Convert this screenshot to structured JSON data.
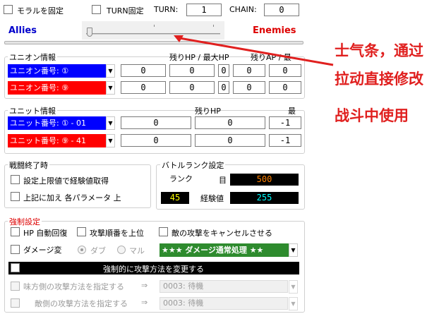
{
  "top": {
    "moral_lock": "モラルを固定",
    "turn_lock": "TURN固定",
    "turn_label": "TURN:",
    "turn_value": "1",
    "chain_label": "CHAIN:",
    "chain_value": "0"
  },
  "morale": {
    "allies": "Allies",
    "enemies": "Enemies"
  },
  "union": {
    "title": "ユニオン情報",
    "header": "残りHP / 最大HP",
    "header_ap": "残りAP / 最",
    "rows": [
      {
        "label": "ユニオン番号: ①",
        "color": "blue",
        "v1": "0",
        "v2": "0",
        "v3": "0",
        "v4": "0",
        "v5": "0"
      },
      {
        "label": "ユニオン番号: ⑨",
        "color": "red",
        "v1": "0",
        "v2": "0",
        "v3": "0",
        "v4": "0",
        "v5": "0"
      }
    ]
  },
  "unit": {
    "title": "ユニット情報",
    "header_hp": "残りHP",
    "header_max": "最",
    "rows": [
      {
        "label": "ユニット番号: ① - 01",
        "color": "blue",
        "v1": "0",
        "v2": "0",
        "v3": "-1"
      },
      {
        "label": "ユニット番号: ⑨ - 41",
        "color": "red",
        "v1": "0",
        "v2": "0",
        "v3": "-1"
      }
    ]
  },
  "battle_end": {
    "title": "戦闘終了時",
    "opt1": "設定上限値で経験値取得",
    "opt2": "上記に加え 各パラメータ 上"
  },
  "battle_rank": {
    "title": "バトルランク設定",
    "rank_label": "ランク",
    "target_label": "目",
    "target_value": "500",
    "rank_value": "45",
    "exp_label": "経験値",
    "exp_value": "255",
    "color_target": "#ff8000",
    "color_rank": "#ffff00",
    "color_exp": "#00ffff"
  },
  "force": {
    "title": "強制設定",
    "hp_regen": "HP 自動回復",
    "attack_first": "攻撃順番を上位",
    "cancel_enemy": "敵の攻撃をキャンセルさせる",
    "damage_change": "ダメージ変",
    "dmg_radio_1": "ダブ",
    "dmg_radio_2": "マル",
    "damage_select": "★★★   ダメージ通常処理  ★★",
    "force_attack_bar": "強制的に攻撃方法を変更する",
    "ally_attack": "味方側の攻撃方法を指定する",
    "ally_arrow": "⇒",
    "ally_value": "0003: 待機",
    "enemy_attack": "敵側の攻撃方法を指定する",
    "enemy_arrow": "⇒",
    "enemy_value": "0003: 待機"
  },
  "annotation": {
    "line1": "士气条，通过",
    "line2": "拉动直接修改",
    "line3": "战斗中使用"
  }
}
